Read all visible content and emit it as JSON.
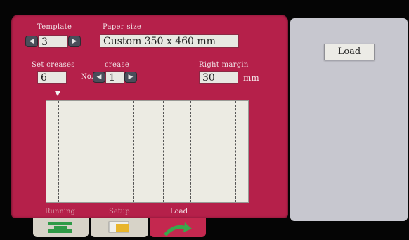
{
  "template": {
    "label": "Template",
    "value": "3"
  },
  "paper_size": {
    "label": "Paper size",
    "value": "Custom 350 x 460 mm"
  },
  "set_creases": {
    "label": "Set creases",
    "value": "6"
  },
  "crease": {
    "label": "crease",
    "no_label": "No.",
    "value": "1"
  },
  "right_margin": {
    "label": "Right margin",
    "value": "30",
    "unit": "mm"
  },
  "side_panel": {
    "load_button": "Load"
  },
  "bottom_tabs": [
    {
      "label": "Running"
    },
    {
      "label": "Setup"
    },
    {
      "label": "Load"
    }
  ],
  "arrows": {
    "left": "◀",
    "right": "▶"
  },
  "colors": {
    "panel": "#b5204a",
    "side": "#c7c7cf"
  }
}
